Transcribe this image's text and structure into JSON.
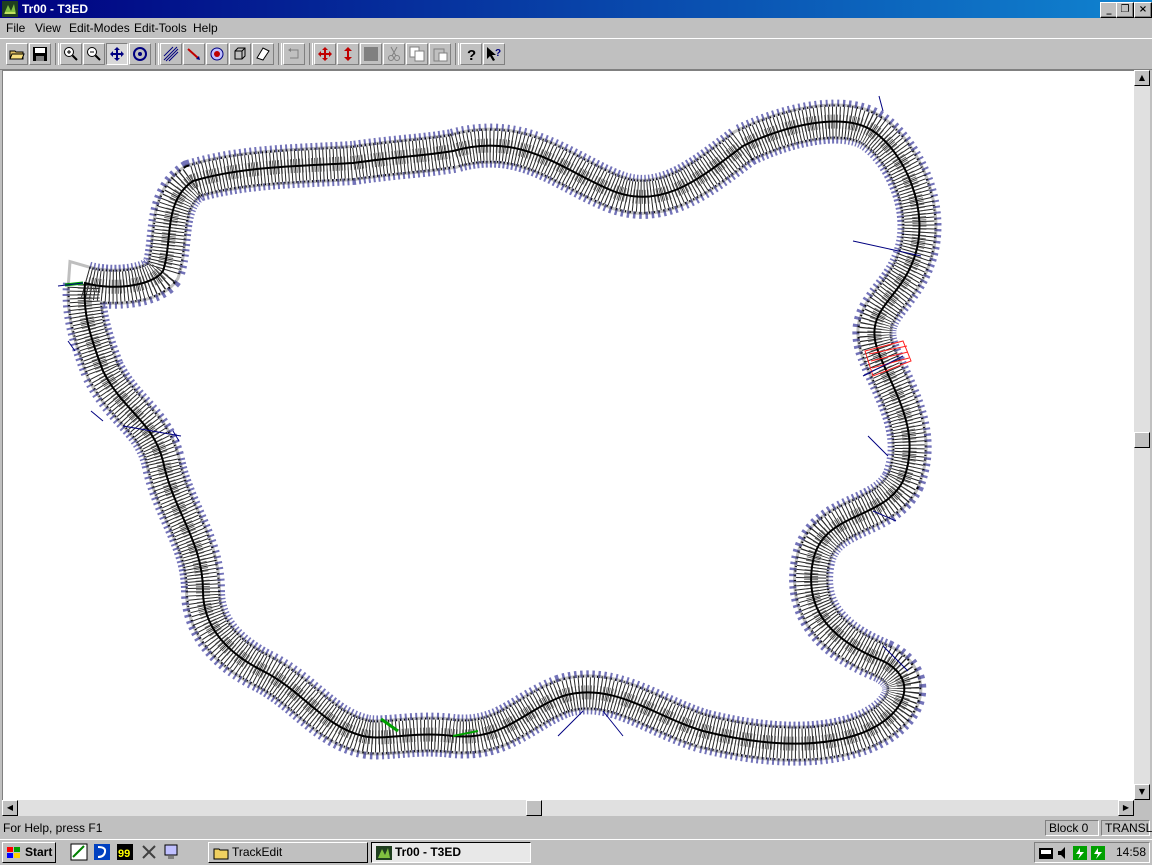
{
  "window": {
    "title": "Tr00 - T3ED"
  },
  "caption_buttons": {
    "minimize": "_",
    "restore": "❐",
    "close": "×"
  },
  "menu": [
    {
      "label": "File"
    },
    {
      "label": "View"
    },
    {
      "label": "Edit-Modes"
    },
    {
      "label": "Edit-Tools"
    },
    {
      "label": "Help"
    }
  ],
  "toolbar": {
    "buttons": [
      "open-icon",
      "save-icon",
      "zoom-in-icon",
      "zoom-out-icon",
      "pan-icon",
      "rotate-view-icon",
      "track-blocks-icon",
      "edit-point-icon",
      "object-icon",
      "cube-icon",
      "polygon-icon",
      "undo-icon",
      "move-icon",
      "move-vertical-icon",
      "box-icon",
      "cut-icon",
      "copy-icon",
      "paste-icon",
      "help-icon",
      "context-help-icon"
    ]
  },
  "status": {
    "help_text": "For Help, press F1",
    "block": "Block 0",
    "mode": "TRANSL"
  },
  "taskbar": {
    "start_label": "Start",
    "tasks": [
      {
        "label": "TrackEdit"
      },
      {
        "label": "Tr00 - T3ED"
      }
    ],
    "clock": "14:58",
    "quicklaunch_99": "99"
  },
  "colors": {
    "title_active": "#000080",
    "track_mesh": "#000000",
    "track_objects": "#000080",
    "selected_block": "#ff2020",
    "green_markers": "#00a000"
  }
}
